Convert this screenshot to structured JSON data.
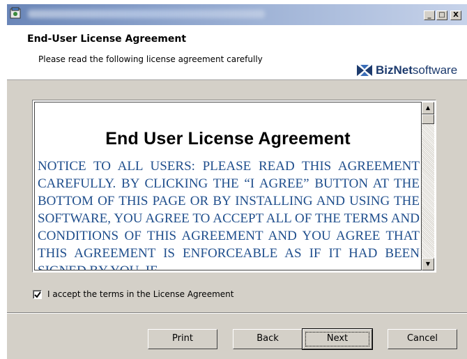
{
  "window": {
    "minimize_glyph": "_",
    "maximize_glyph": "□",
    "close_glyph": "X"
  },
  "header": {
    "title": "End-User License Agreement",
    "subtitle": "Please read the following license agreement carefully",
    "logo": {
      "bold": "BizNet",
      "normal": "software",
      "color": "#1d3b6e"
    }
  },
  "eula": {
    "heading": "End User License Agreement",
    "body": "NOTICE TO ALL USERS: PLEASE READ THIS AGREEMENT CAREFULLY. BY CLICKING THE “I AGREE” BUTTON AT THE BOTTOM OF THIS PAGE OR BY INSTALLING AND USING THE SOFTWARE, YOU AGREE TO ACCEPT ALL OF THE TERMS AND CONDITIONS OF THIS AGREEMENT AND YOU AGREE THAT THIS AGREEMENT IS ENFORCEABLE AS IF IT HAD BEEN SIGNED BY YOU. IF",
    "text_color": "#1f4e8c",
    "scroll_up_glyph": "▲",
    "scroll_down_glyph": "▼"
  },
  "accept": {
    "label": "I accept the terms in the License Agreement",
    "checked": true
  },
  "buttons": {
    "print": "Print",
    "back": "Back",
    "next": "Next",
    "cancel": "Cancel"
  }
}
